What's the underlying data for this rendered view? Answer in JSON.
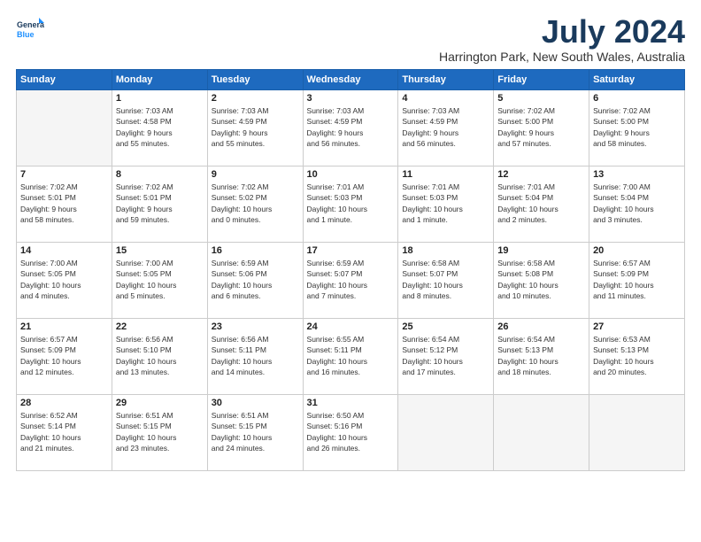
{
  "header": {
    "logo_line1": "General",
    "logo_line2": "Blue",
    "month_year": "July 2024",
    "location": "Harrington Park, New South Wales, Australia"
  },
  "weekdays": [
    "Sunday",
    "Monday",
    "Tuesday",
    "Wednesday",
    "Thursday",
    "Friday",
    "Saturday"
  ],
  "weeks": [
    [
      {
        "day": "",
        "info": ""
      },
      {
        "day": "1",
        "info": "Sunrise: 7:03 AM\nSunset: 4:58 PM\nDaylight: 9 hours\nand 55 minutes."
      },
      {
        "day": "2",
        "info": "Sunrise: 7:03 AM\nSunset: 4:59 PM\nDaylight: 9 hours\nand 55 minutes."
      },
      {
        "day": "3",
        "info": "Sunrise: 7:03 AM\nSunset: 4:59 PM\nDaylight: 9 hours\nand 56 minutes."
      },
      {
        "day": "4",
        "info": "Sunrise: 7:03 AM\nSunset: 4:59 PM\nDaylight: 9 hours\nand 56 minutes."
      },
      {
        "day": "5",
        "info": "Sunrise: 7:02 AM\nSunset: 5:00 PM\nDaylight: 9 hours\nand 57 minutes."
      },
      {
        "day": "6",
        "info": "Sunrise: 7:02 AM\nSunset: 5:00 PM\nDaylight: 9 hours\nand 58 minutes."
      }
    ],
    [
      {
        "day": "7",
        "info": "Sunrise: 7:02 AM\nSunset: 5:01 PM\nDaylight: 9 hours\nand 58 minutes."
      },
      {
        "day": "8",
        "info": "Sunrise: 7:02 AM\nSunset: 5:01 PM\nDaylight: 9 hours\nand 59 minutes."
      },
      {
        "day": "9",
        "info": "Sunrise: 7:02 AM\nSunset: 5:02 PM\nDaylight: 10 hours\nand 0 minutes."
      },
      {
        "day": "10",
        "info": "Sunrise: 7:01 AM\nSunset: 5:03 PM\nDaylight: 10 hours\nand 1 minute."
      },
      {
        "day": "11",
        "info": "Sunrise: 7:01 AM\nSunset: 5:03 PM\nDaylight: 10 hours\nand 1 minute."
      },
      {
        "day": "12",
        "info": "Sunrise: 7:01 AM\nSunset: 5:04 PM\nDaylight: 10 hours\nand 2 minutes."
      },
      {
        "day": "13",
        "info": "Sunrise: 7:00 AM\nSunset: 5:04 PM\nDaylight: 10 hours\nand 3 minutes."
      }
    ],
    [
      {
        "day": "14",
        "info": "Sunrise: 7:00 AM\nSunset: 5:05 PM\nDaylight: 10 hours\nand 4 minutes."
      },
      {
        "day": "15",
        "info": "Sunrise: 7:00 AM\nSunset: 5:05 PM\nDaylight: 10 hours\nand 5 minutes."
      },
      {
        "day": "16",
        "info": "Sunrise: 6:59 AM\nSunset: 5:06 PM\nDaylight: 10 hours\nand 6 minutes."
      },
      {
        "day": "17",
        "info": "Sunrise: 6:59 AM\nSunset: 5:07 PM\nDaylight: 10 hours\nand 7 minutes."
      },
      {
        "day": "18",
        "info": "Sunrise: 6:58 AM\nSunset: 5:07 PM\nDaylight: 10 hours\nand 8 minutes."
      },
      {
        "day": "19",
        "info": "Sunrise: 6:58 AM\nSunset: 5:08 PM\nDaylight: 10 hours\nand 10 minutes."
      },
      {
        "day": "20",
        "info": "Sunrise: 6:57 AM\nSunset: 5:09 PM\nDaylight: 10 hours\nand 11 minutes."
      }
    ],
    [
      {
        "day": "21",
        "info": "Sunrise: 6:57 AM\nSunset: 5:09 PM\nDaylight: 10 hours\nand 12 minutes."
      },
      {
        "day": "22",
        "info": "Sunrise: 6:56 AM\nSunset: 5:10 PM\nDaylight: 10 hours\nand 13 minutes."
      },
      {
        "day": "23",
        "info": "Sunrise: 6:56 AM\nSunset: 5:11 PM\nDaylight: 10 hours\nand 14 minutes."
      },
      {
        "day": "24",
        "info": "Sunrise: 6:55 AM\nSunset: 5:11 PM\nDaylight: 10 hours\nand 16 minutes."
      },
      {
        "day": "25",
        "info": "Sunrise: 6:54 AM\nSunset: 5:12 PM\nDaylight: 10 hours\nand 17 minutes."
      },
      {
        "day": "26",
        "info": "Sunrise: 6:54 AM\nSunset: 5:13 PM\nDaylight: 10 hours\nand 18 minutes."
      },
      {
        "day": "27",
        "info": "Sunrise: 6:53 AM\nSunset: 5:13 PM\nDaylight: 10 hours\nand 20 minutes."
      }
    ],
    [
      {
        "day": "28",
        "info": "Sunrise: 6:52 AM\nSunset: 5:14 PM\nDaylight: 10 hours\nand 21 minutes."
      },
      {
        "day": "29",
        "info": "Sunrise: 6:51 AM\nSunset: 5:15 PM\nDaylight: 10 hours\nand 23 minutes."
      },
      {
        "day": "30",
        "info": "Sunrise: 6:51 AM\nSunset: 5:15 PM\nDaylight: 10 hours\nand 24 minutes."
      },
      {
        "day": "31",
        "info": "Sunrise: 6:50 AM\nSunset: 5:16 PM\nDaylight: 10 hours\nand 26 minutes."
      },
      {
        "day": "",
        "info": ""
      },
      {
        "day": "",
        "info": ""
      },
      {
        "day": "",
        "info": ""
      }
    ]
  ]
}
